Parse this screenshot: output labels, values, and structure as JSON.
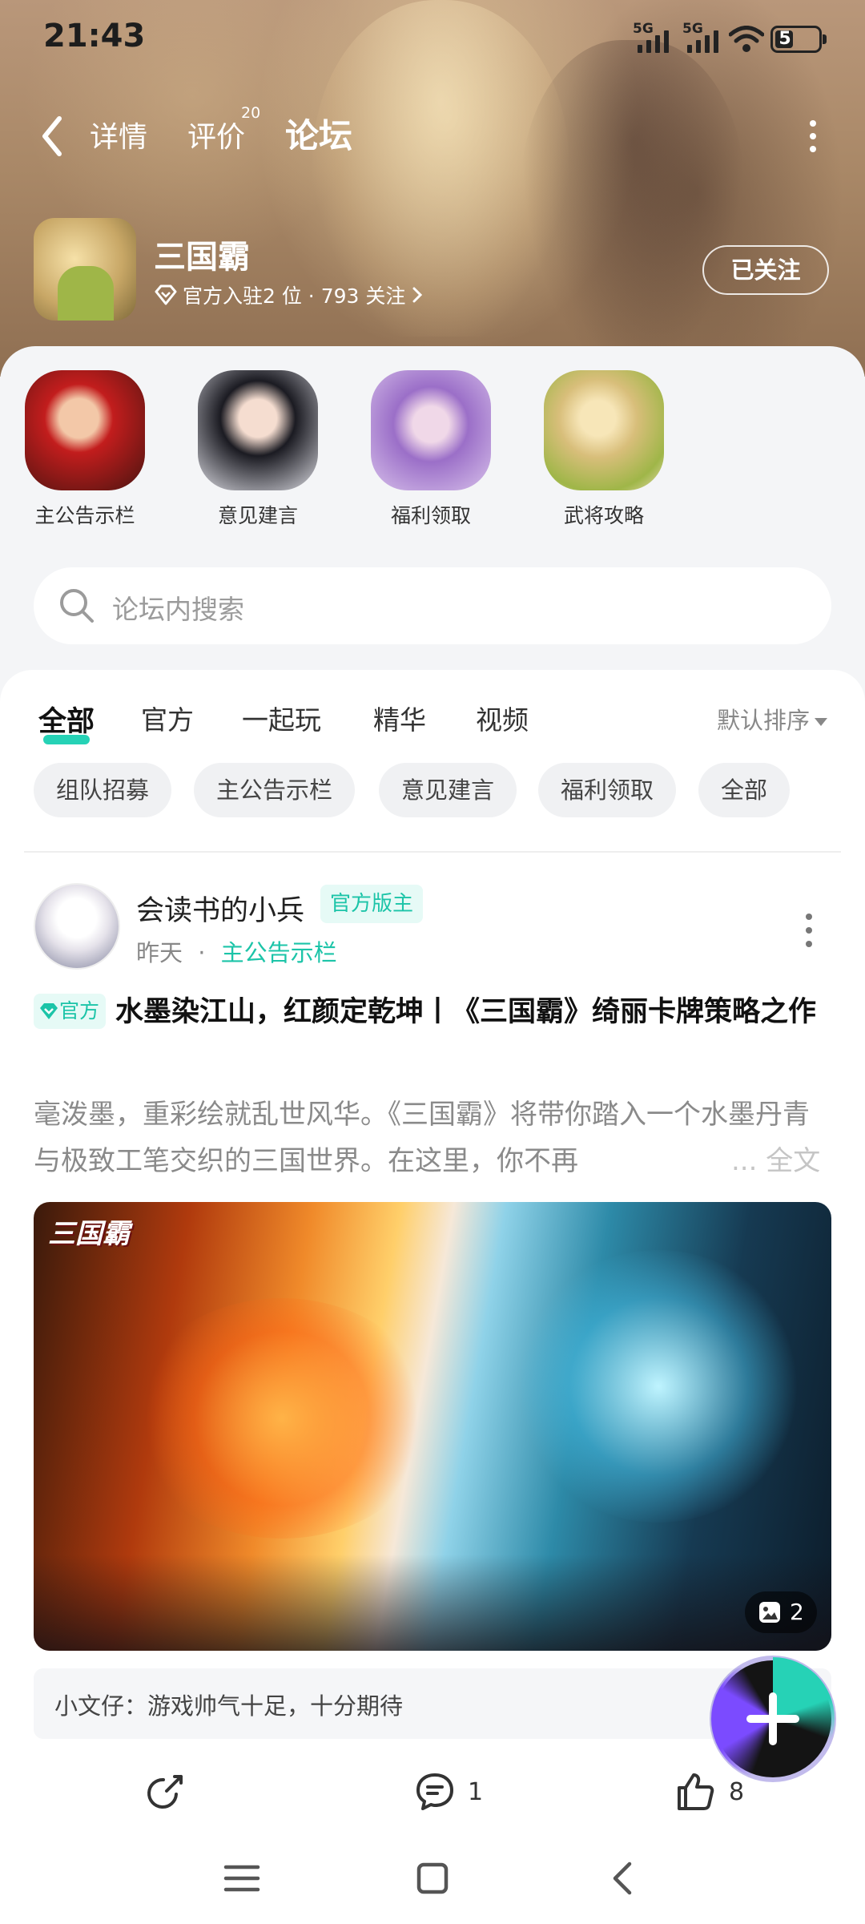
{
  "status_bar": {
    "time": "21:43",
    "sim1": "5G",
    "sim2": "5G",
    "battery": "5"
  },
  "nav": {
    "tabs": [
      {
        "label": "详情"
      },
      {
        "label": "评价",
        "badge": "20"
      },
      {
        "label": "论坛"
      }
    ],
    "active_tab": "论坛"
  },
  "game": {
    "title": "三国霸",
    "sub": "官方入驻2 位 · 793 关注",
    "follow_label": "已关注"
  },
  "categories": [
    {
      "label": "主公告示栏"
    },
    {
      "label": "意见建言"
    },
    {
      "label": "福利领取"
    },
    {
      "label": "武将攻略"
    }
  ],
  "search": {
    "placeholder": "论坛内搜索"
  },
  "feed_tabs": [
    {
      "label": "全部"
    },
    {
      "label": "官方"
    },
    {
      "label": "一起玩"
    },
    {
      "label": "精华"
    },
    {
      "label": "视频"
    }
  ],
  "sort_label": "默认排序",
  "chips": [
    "组队招募",
    "主公告示栏",
    "意见建言",
    "福利领取",
    "全部"
  ],
  "post": {
    "author": "会读书的小兵",
    "role_badge": "官方版主",
    "time": "昨天",
    "separator": "·",
    "board": "主公告示栏",
    "official_tag": "官方",
    "title": "水墨染江山，红颜定乾坤丨《三国霸》绮丽卡牌策略之作",
    "excerpt": "毫泼墨，重彩绘就乱世风华。《三国霸》将带你踏入一个水墨丹青与极致工笔交织的三国世界。在这里，你不再",
    "more": "... 全文",
    "image_logo": "三国霸",
    "image_count": "2",
    "top_comment": "小文仔：游戏帅气十足，十分期待",
    "comments": "1",
    "likes": "8"
  },
  "colors": {
    "accent": "#26d2b6",
    "accent_text": "#1cc4a8"
  }
}
